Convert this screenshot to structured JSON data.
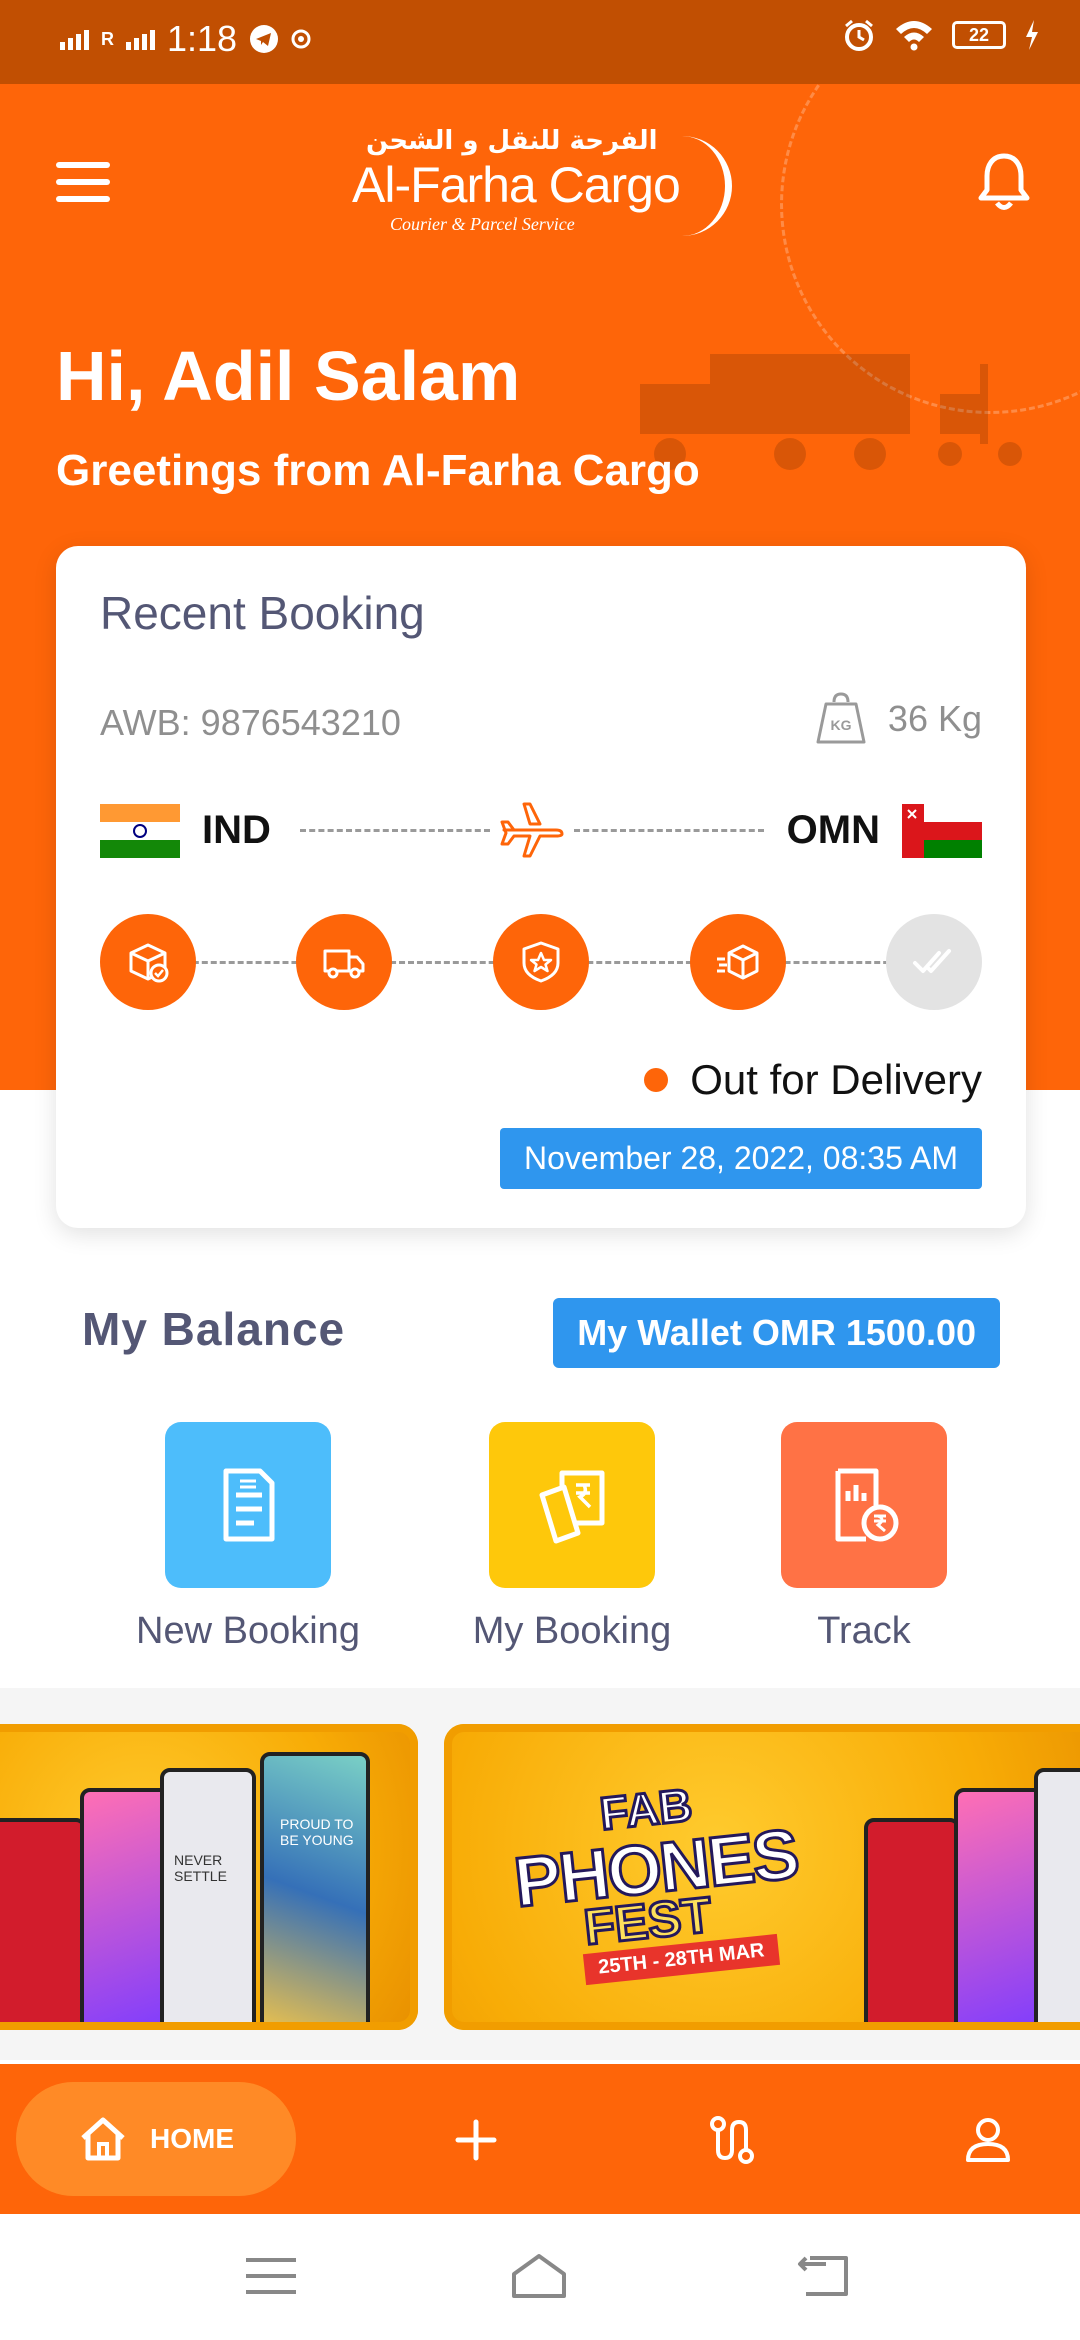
{
  "status_bar": {
    "time": "1:18",
    "signal1_label": "R",
    "battery": "22"
  },
  "brand": {
    "arabic": "الفرحة للنقل و الشحن",
    "name": "Al-Farha Cargo",
    "tagline": "Courier & Parcel Service"
  },
  "header": {
    "greeting": "Hi, Adil Salam",
    "subtitle": "Greetings from Al-Farha Cargo"
  },
  "booking": {
    "title": "Recent Booking",
    "awb": "AWB: 9876543210",
    "weight": "36 Kg",
    "weight_icon_text": "KG",
    "from_code": "IND",
    "to_code": "OMN",
    "status": "Out for Delivery",
    "date": "November 28, 2022, 08:35 AM",
    "steps": [
      "box-check-icon",
      "truck-icon",
      "badge-star-icon",
      "package-fast-icon",
      "double-check-icon"
    ],
    "completed_steps": 4
  },
  "balance": {
    "title": "My Balance",
    "wallet": "My Wallet OMR 1500.00"
  },
  "actions": [
    {
      "label": "New Booking",
      "icon": "invoice-icon",
      "color": "#4dbdfb"
    },
    {
      "label": "My Booking",
      "icon": "bills-icon",
      "color": "#fec80b"
    },
    {
      "label": "Track",
      "icon": "receipt-rupee-icon",
      "color": "#ff7245"
    }
  ],
  "banners": {
    "promo_line1": "FAB",
    "promo_line2": "PHONES",
    "promo_line3": "FEST",
    "promo_dates": "25TH - 28TH MAR",
    "phone_text_1": "NEVER SETTLE",
    "phone_text_2": "PROUD TO BE YOUNG"
  },
  "bottom_nav": {
    "home": "HOME"
  },
  "colors": {
    "primary": "#fe6509",
    "status_bar": "#c14f02",
    "accent_blue": "#2f96ee",
    "text_muted": "#545775"
  }
}
